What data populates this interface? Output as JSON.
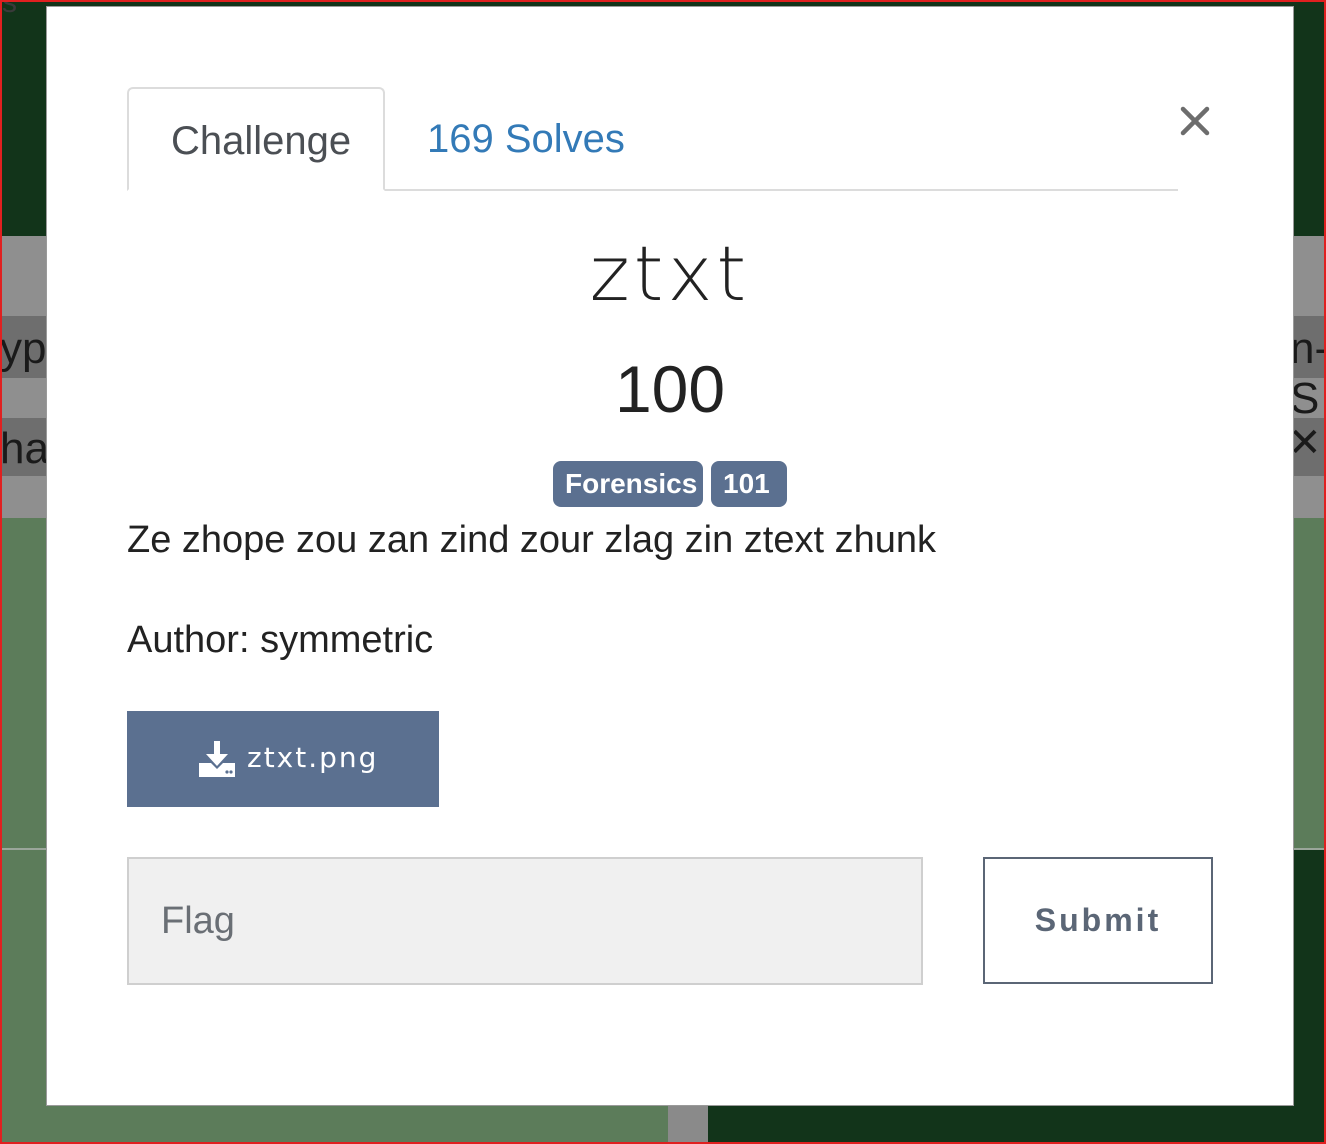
{
  "background": {
    "peek_left_top": "s",
    "peek_left_1": "ypt",
    "peek_left_2": "hal",
    "peek_right_1": "n-S",
    "peek_right_close": "✕"
  },
  "modal": {
    "tabs": [
      {
        "label": "Challenge",
        "active": true
      },
      {
        "label": "169 Solves",
        "active": false
      }
    ],
    "close_icon": "close-icon",
    "challenge": {
      "name": "ztxt",
      "points": "100",
      "tags": [
        "Forensics",
        "101"
      ],
      "description": "Ze zhope zou zan zind zour zlag zin ztext zhunk",
      "author": "Author: symmetric",
      "file": {
        "icon": "download-icon",
        "name": "ztxt.png"
      }
    },
    "flag_form": {
      "placeholder": "Flag",
      "value": "",
      "submit_label": "Submit"
    }
  },
  "colors": {
    "tag_bg": "#5b7090",
    "link": "#337ab7",
    "background_dark_green": "#12341a",
    "background_green": "#5c7c5a",
    "frame_border": "#e02020"
  }
}
